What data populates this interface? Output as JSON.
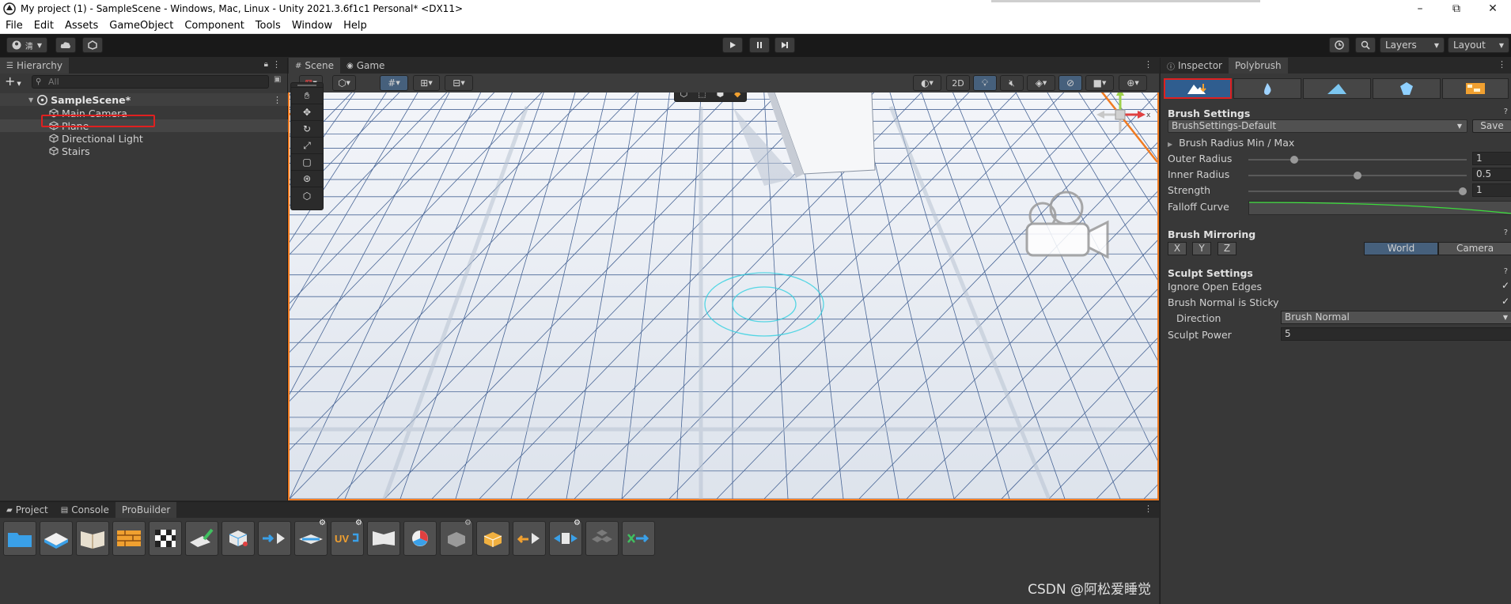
{
  "window": {
    "title": "My project (1) - SampleScene - Windows, Mac, Linux - Unity 2021.3.6f1c1 Personal* <DX11>",
    "minimize": "–",
    "maximize": "⧉",
    "close": "✕"
  },
  "menu": [
    "File",
    "Edit",
    "Assets",
    "GameObject",
    "Component",
    "Tools",
    "Window",
    "Help"
  ],
  "toolbar": {
    "account_label": "清",
    "layers_label": "Layers",
    "layout_label": "Layout"
  },
  "hierarchy": {
    "tab_label": "Hierarchy",
    "search_placeholder": "All",
    "scene_name": "SampleScene*",
    "items": [
      "Main Camera",
      "Plane",
      "Directional Light",
      "Stairs"
    ]
  },
  "scene": {
    "tabs": [
      "Scene",
      "Game"
    ],
    "btn_2d": "2D",
    "gizmo_y": "y",
    "gizmo_x": "x",
    "colors": {
      "selection_outline": "#f07b22",
      "highlight": "#e02020"
    }
  },
  "inspector": {
    "tabs": [
      "Inspector",
      "Polybrush"
    ],
    "brush_settings": {
      "header": "Brush Settings",
      "preset": "BrushSettings-Default",
      "save_label": "Save",
      "radius_fold": "Brush Radius Min / Max",
      "outer_radius_label": "Outer Radius",
      "outer_radius_value": "1",
      "outer_radius_fraction": 0.2,
      "inner_radius_label": "Inner Radius",
      "inner_radius_value": "0.5",
      "inner_radius_fraction": 0.5,
      "strength_label": "Strength",
      "strength_value": "1",
      "strength_fraction": 1.0,
      "falloff_label": "Falloff Curve"
    },
    "mirroring": {
      "header": "Brush Mirroring",
      "axes": [
        "X",
        "Y",
        "Z"
      ],
      "world_label": "World",
      "camera_label": "Camera"
    },
    "sculpt": {
      "header": "Sculpt Settings",
      "ignore_open_edges_label": "Ignore Open Edges",
      "normal_sticky_label": "Brush Normal is Sticky",
      "direction_label": "Direction",
      "direction_value": "Brush Normal",
      "power_label": "Sculpt Power",
      "power_value": "5"
    }
  },
  "bottom": {
    "tabs": [
      "Project",
      "Console",
      "ProBuilder"
    ]
  },
  "watermark": "CSDN @阿松爱睡觉"
}
